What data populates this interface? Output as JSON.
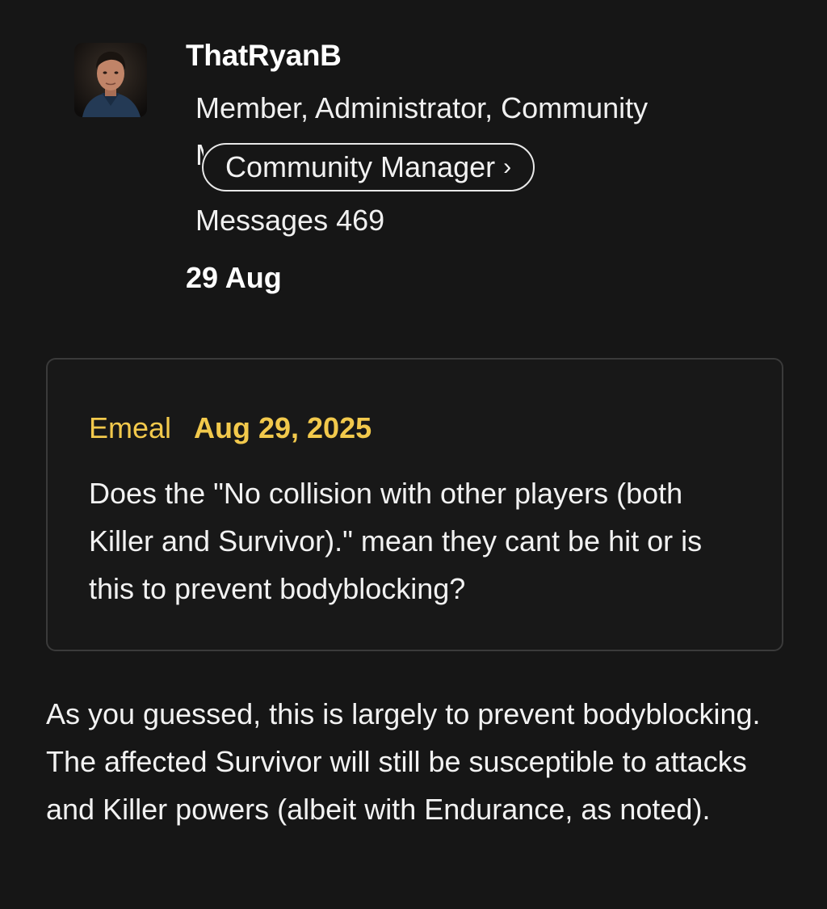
{
  "author": {
    "username": "ThatRyanB",
    "roles": "Member, Administrator, Community",
    "roles_overflow": "M",
    "title_badge": "Community Manager",
    "messages_label": "Messages",
    "messages_count": "469",
    "post_date": "29 Aug"
  },
  "quote": {
    "author": "Emeal",
    "date": "Aug 29, 2025",
    "text": "Does the \"No collision with other players (both Killer and Survivor).\" mean they cant be hit or is this to prevent bodyblocking?"
  },
  "reply": {
    "text": "As you guessed, this is largely to prevent bodyblocking. The affected Survivor will still be susceptible to attacks and Killer powers (albeit with Endurance, as noted)."
  },
  "icons": {
    "chevron": "chevron-right-icon",
    "avatar": "avatar-portrait"
  }
}
